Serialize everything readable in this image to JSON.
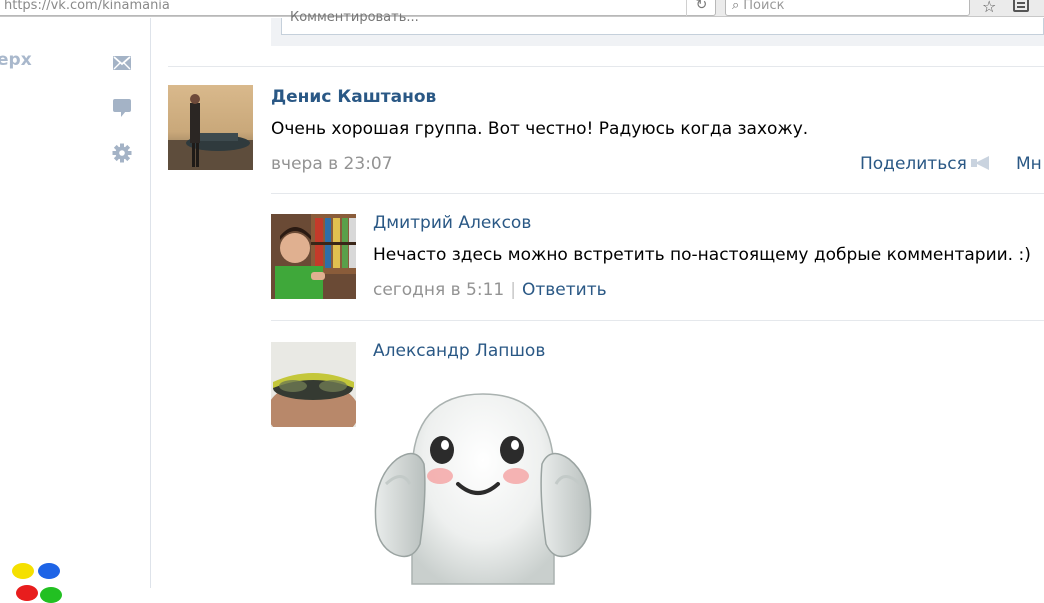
{
  "browser": {
    "url": "https://vk.com/kinamania",
    "search_placeholder": "Поиск"
  },
  "sidebar": {
    "up_link": "ерх"
  },
  "comment_box": {
    "placeholder": "Комментировать..."
  },
  "posts": [
    {
      "author": "Денис Каштанов",
      "text": "Очень хорошая группа. Вот честно! Радуюсь когда захожу.",
      "time": "вчера в 23:07",
      "share_label": "Поделиться",
      "more_label": "Мн"
    }
  ],
  "replies": [
    {
      "author": "Дмитрий Алексов",
      "text": "Нечасто здесь можно встретить по-настоящему добрые комментарии. :)",
      "time": "сегодня в 5:11",
      "separator": "|",
      "reply_label": "Ответить"
    },
    {
      "author": "Александр Лапшов",
      "sticker": "ghost-sticker"
    }
  ],
  "colors": {
    "link": "#2a5885",
    "meta": "#939393",
    "sidebar_icon": "#a4b3c6"
  }
}
